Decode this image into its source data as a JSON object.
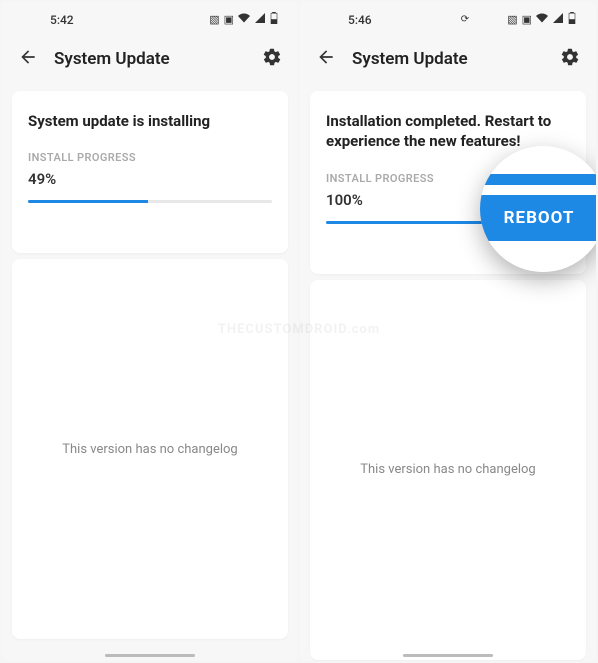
{
  "watermark": "THECUSTOMDROID.com",
  "left": {
    "status_time": "5:42",
    "header_title": "System Update",
    "update_title": "System update is installing",
    "progress_label": "INSTALL PROGRESS",
    "progress_value": "49%",
    "progress_percent": 49,
    "changelog_text": "This version has no changelog"
  },
  "right": {
    "status_time": "5:46",
    "header_title": "System Update",
    "update_title": "Installation completed. Restart to experience the new features!",
    "progress_label": "INSTALL PROGRESS",
    "progress_value": "100%",
    "progress_percent": 100,
    "changelog_text": "This version has no changelog",
    "reboot_label": "REBOOT"
  }
}
